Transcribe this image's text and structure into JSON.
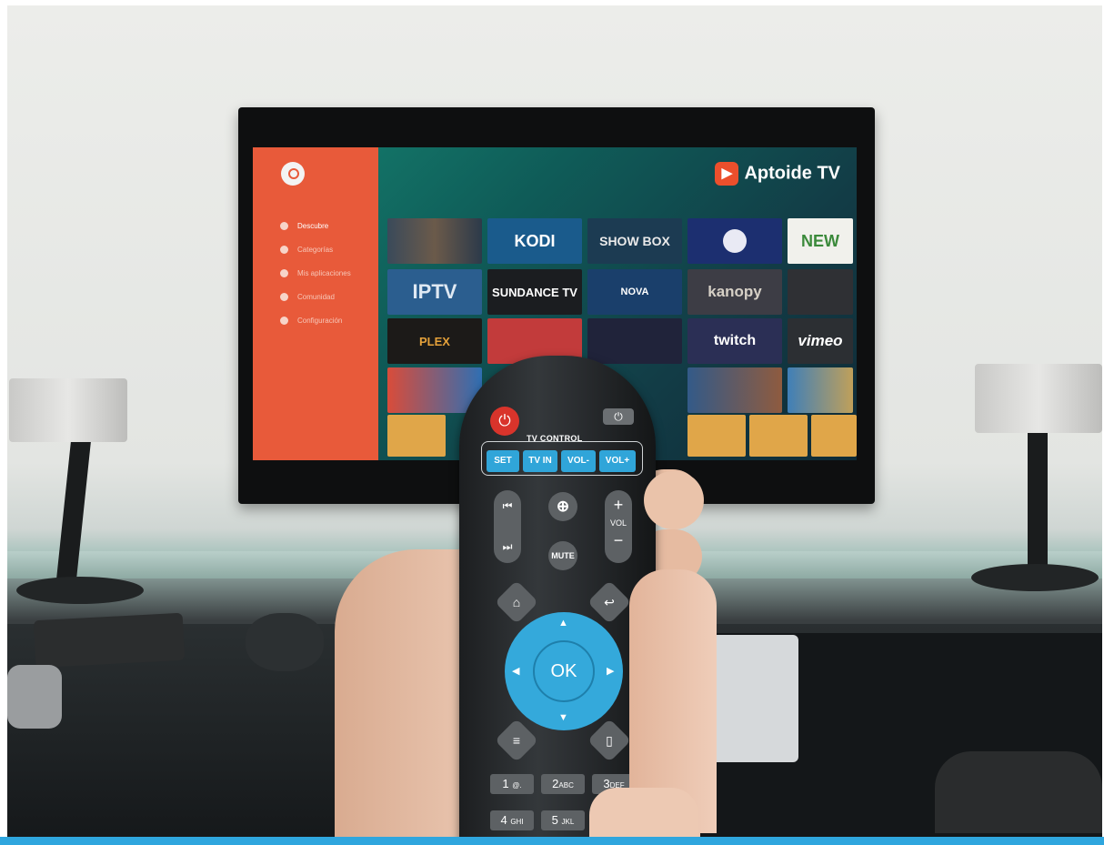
{
  "tv_screen": {
    "brand": "Aptoide TV",
    "menu": [
      "Descubre",
      "Categorías",
      "Mis aplicaciones",
      "Comunidad",
      "Configuración"
    ],
    "tiles_row1": [
      "",
      "KODI",
      "SHOW BOX",
      "",
      "NEW"
    ],
    "tiles_row2": [
      "IPTV",
      "SUNDANCE TV",
      "NOVA",
      "kanopy",
      ""
    ],
    "tiles_row3": [
      "PLEX",
      "",
      "",
      "twitch",
      "vimeo"
    ]
  },
  "remote": {
    "tv_control_label": "TV CONTROL",
    "tv_control_buttons": [
      "SET",
      "TV IN",
      "VOL-",
      "VOL+"
    ],
    "vol_label": "VOL",
    "vol_plus": "+",
    "vol_minus": "−",
    "mute_label": "MUTE",
    "ok_label": "OK",
    "keys": [
      {
        "num": "1",
        "letters": "@."
      },
      {
        "num": "2",
        "letters": "ABC"
      },
      {
        "num": "3",
        "letters": "DEF"
      },
      {
        "num": "4",
        "letters": "GHI"
      },
      {
        "num": "5",
        "letters": "JKL"
      }
    ]
  },
  "colors": {
    "accent_blue": "#34a9db",
    "aptoide_orange": "#e85a3a",
    "power_red": "#d9342b"
  }
}
